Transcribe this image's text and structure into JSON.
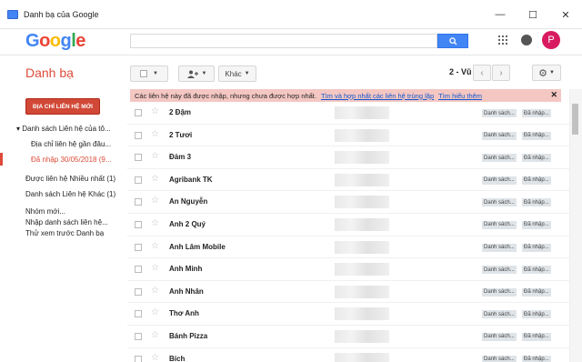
{
  "window": {
    "title": "Danh bạ của Google",
    "minimize": "—",
    "maximize": "☐",
    "close": "✕"
  },
  "logo": {
    "letters": [
      {
        "ch": "G",
        "color": "#4285f4"
      },
      {
        "ch": "o",
        "color": "#ea4335"
      },
      {
        "ch": "o",
        "color": "#fbbc05"
      },
      {
        "ch": "g",
        "color": "#4285f4"
      },
      {
        "ch": "l",
        "color": "#34a853"
      },
      {
        "ch": "e",
        "color": "#ea4335"
      }
    ]
  },
  "header": {
    "avatar_letter": "P"
  },
  "app_title": "Danh bạ",
  "toolbar": {
    "more_label": "Khác",
    "pager": "2 - Vũ"
  },
  "sidebar": {
    "new_contact": "ĐỊA CHỈ LIÊN HỆ MỚI",
    "items": [
      {
        "label": "▾  Danh sách Liên hệ của tô...",
        "cls": ""
      },
      {
        "label": "Địa chỉ liên hệ gần đâu...",
        "cls": "sub"
      },
      {
        "label": "Đã nhập 30/05/2018 (9...",
        "cls": "active"
      },
      {
        "label": "Được liên hệ Nhiều nhất (1)",
        "cls": ""
      },
      {
        "label": "Danh sách Liên hệ Khác (1)",
        "cls": ""
      },
      {
        "label": "Nhóm mới...",
        "cls": ""
      },
      {
        "label": "Nhập danh sách liên hệ...",
        "cls": ""
      },
      {
        "label": "Thử xem trước Danh bạ",
        "cls": ""
      }
    ]
  },
  "notice": {
    "text": "Các liên hệ này đã được nhập, nhưng chưa được hợp nhất.",
    "link1": "Tìm và hợp nhất các liên hệ trùng lặp",
    "link2": "Tìm hiểu thêm",
    "close": "✕"
  },
  "tags": {
    "tag1": "Danh sách...",
    "tag2": "Đã nhập..."
  },
  "contacts": [
    "2 Đậm",
    "2 Tươi",
    "Đảm 3",
    "Agribank TK",
    "An Nguyễn",
    "Anh 2 Quý",
    "Anh Lâm Mobile",
    "Anh Minh",
    "Anh Nhân",
    "Thơ Anh",
    "Bánh Pizza",
    "Bích"
  ],
  "colors": {
    "accent": "#dd4b39",
    "search_button": "#4285f4",
    "notice_bg": "#f4c7c3",
    "link": "#1155cc"
  }
}
